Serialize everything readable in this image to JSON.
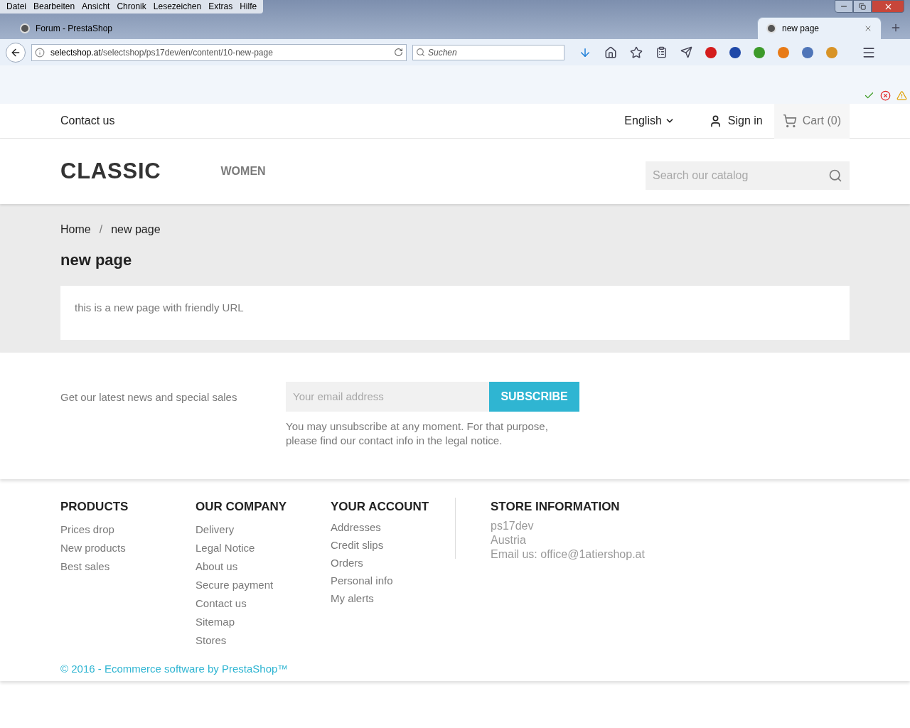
{
  "browser": {
    "menu": [
      "Datei",
      "Bearbeiten",
      "Ansicht",
      "Chronik",
      "Lesezeichen",
      "Extras",
      "Hilfe"
    ],
    "tabs": [
      {
        "title": "Forum - PrestaShop",
        "selected": false
      },
      {
        "title": "new page",
        "selected": true
      }
    ],
    "url_host": "selectshop.at",
    "url_path": "/selectshop/ps17dev/en/content/10-new-page",
    "search_placeholder": "Suchen"
  },
  "topbar": {
    "contact": "Contact us",
    "language": "English",
    "sign_in": "Sign in",
    "cart": "Cart (0)"
  },
  "header": {
    "logo": "CLASSIC",
    "menu": [
      "WOMEN"
    ],
    "search_placeholder": "Search our catalog"
  },
  "breadcrumb": {
    "separator": "/",
    "items": [
      "Home",
      "new page"
    ]
  },
  "page": {
    "title": "new page",
    "content": "this is a new page with friendly URL"
  },
  "newsletter": {
    "label": "Get our latest news and special sales",
    "placeholder": "Your email address",
    "button": "SUBSCRIBE",
    "note": "You may unsubscribe at any moment. For that purpose, please find our contact info in the legal notice."
  },
  "footer": {
    "columns": [
      {
        "title": "PRODUCTS",
        "links": [
          "Prices drop",
          "New products",
          "Best sales"
        ]
      },
      {
        "title": "OUR COMPANY",
        "links": [
          "Delivery",
          "Legal Notice",
          "About us",
          "Secure payment",
          "Contact us",
          "Sitemap",
          "Stores"
        ]
      },
      {
        "title": "YOUR ACCOUNT",
        "links": [
          "Addresses",
          "Credit slips",
          "Orders",
          "Personal info",
          "My alerts"
        ]
      }
    ],
    "store": {
      "title": "STORE INFORMATION",
      "lines": [
        "ps17dev",
        "Austria",
        "Email us: office@1atiershop.at"
      ]
    },
    "copyright": "© 2016 - Ecommerce software by PrestaShop™"
  }
}
